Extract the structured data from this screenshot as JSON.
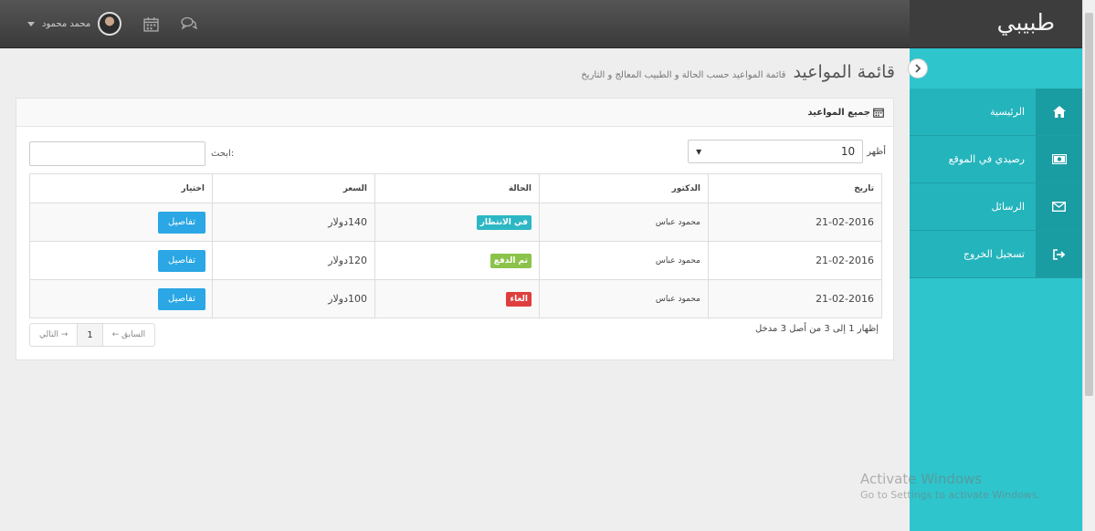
{
  "header": {
    "brand": "طبيبي",
    "user_name": "محمد محمود"
  },
  "sidebar": {
    "items": [
      {
        "label": "الرئيسية",
        "icon": "home-icon"
      },
      {
        "label": "رصيدي في الموقع",
        "icon": "money-icon"
      },
      {
        "label": "الرسائل",
        "icon": "envelope-icon"
      },
      {
        "label": "تسجيل الخروج",
        "icon": "logout-icon"
      }
    ]
  },
  "page": {
    "title": "قائمة المواعيد",
    "subtitle": "قائمة المواعيد حسب الحالة و الطبيب المعالج و التاريخ"
  },
  "panel": {
    "title": "جميع المواعيد",
    "length_label": "أظهر",
    "length_value": "10",
    "search_label": "ابحث:",
    "columns": [
      "تاريخ",
      "الدكتور",
      "الحالة",
      "السعر",
      "اختيار"
    ],
    "rows": [
      {
        "date": "21-02-2016",
        "doctor": "محمود عباس",
        "status": "في الانتظار",
        "price": "140دولار",
        "action": "تفاصيل"
      },
      {
        "date": "21-02-2016",
        "doctor": "محمود عباس",
        "status": "تم الدفع",
        "price": "120دولار",
        "action": "تفاصيل"
      },
      {
        "date": "21-02-2016",
        "doctor": "محمود عباس",
        "status": "الغاء",
        "price": "100دولار",
        "action": "تفاصيل"
      }
    ],
    "info": "إظهار 1 إلى 3 من أصل 3 مدخل",
    "pager": {
      "prev": "← السابق",
      "current": "1",
      "next": "التالي →"
    }
  },
  "watermark": {
    "line1": "Activate Windows",
    "line2": "Go to Settings to activate Windows."
  },
  "colors": {
    "sidebar": "#2ec5cd",
    "waiting": "#2db7c4",
    "paid": "#8bc34a",
    "cancel": "#e03e3e",
    "button": "#2aa7e4"
  }
}
